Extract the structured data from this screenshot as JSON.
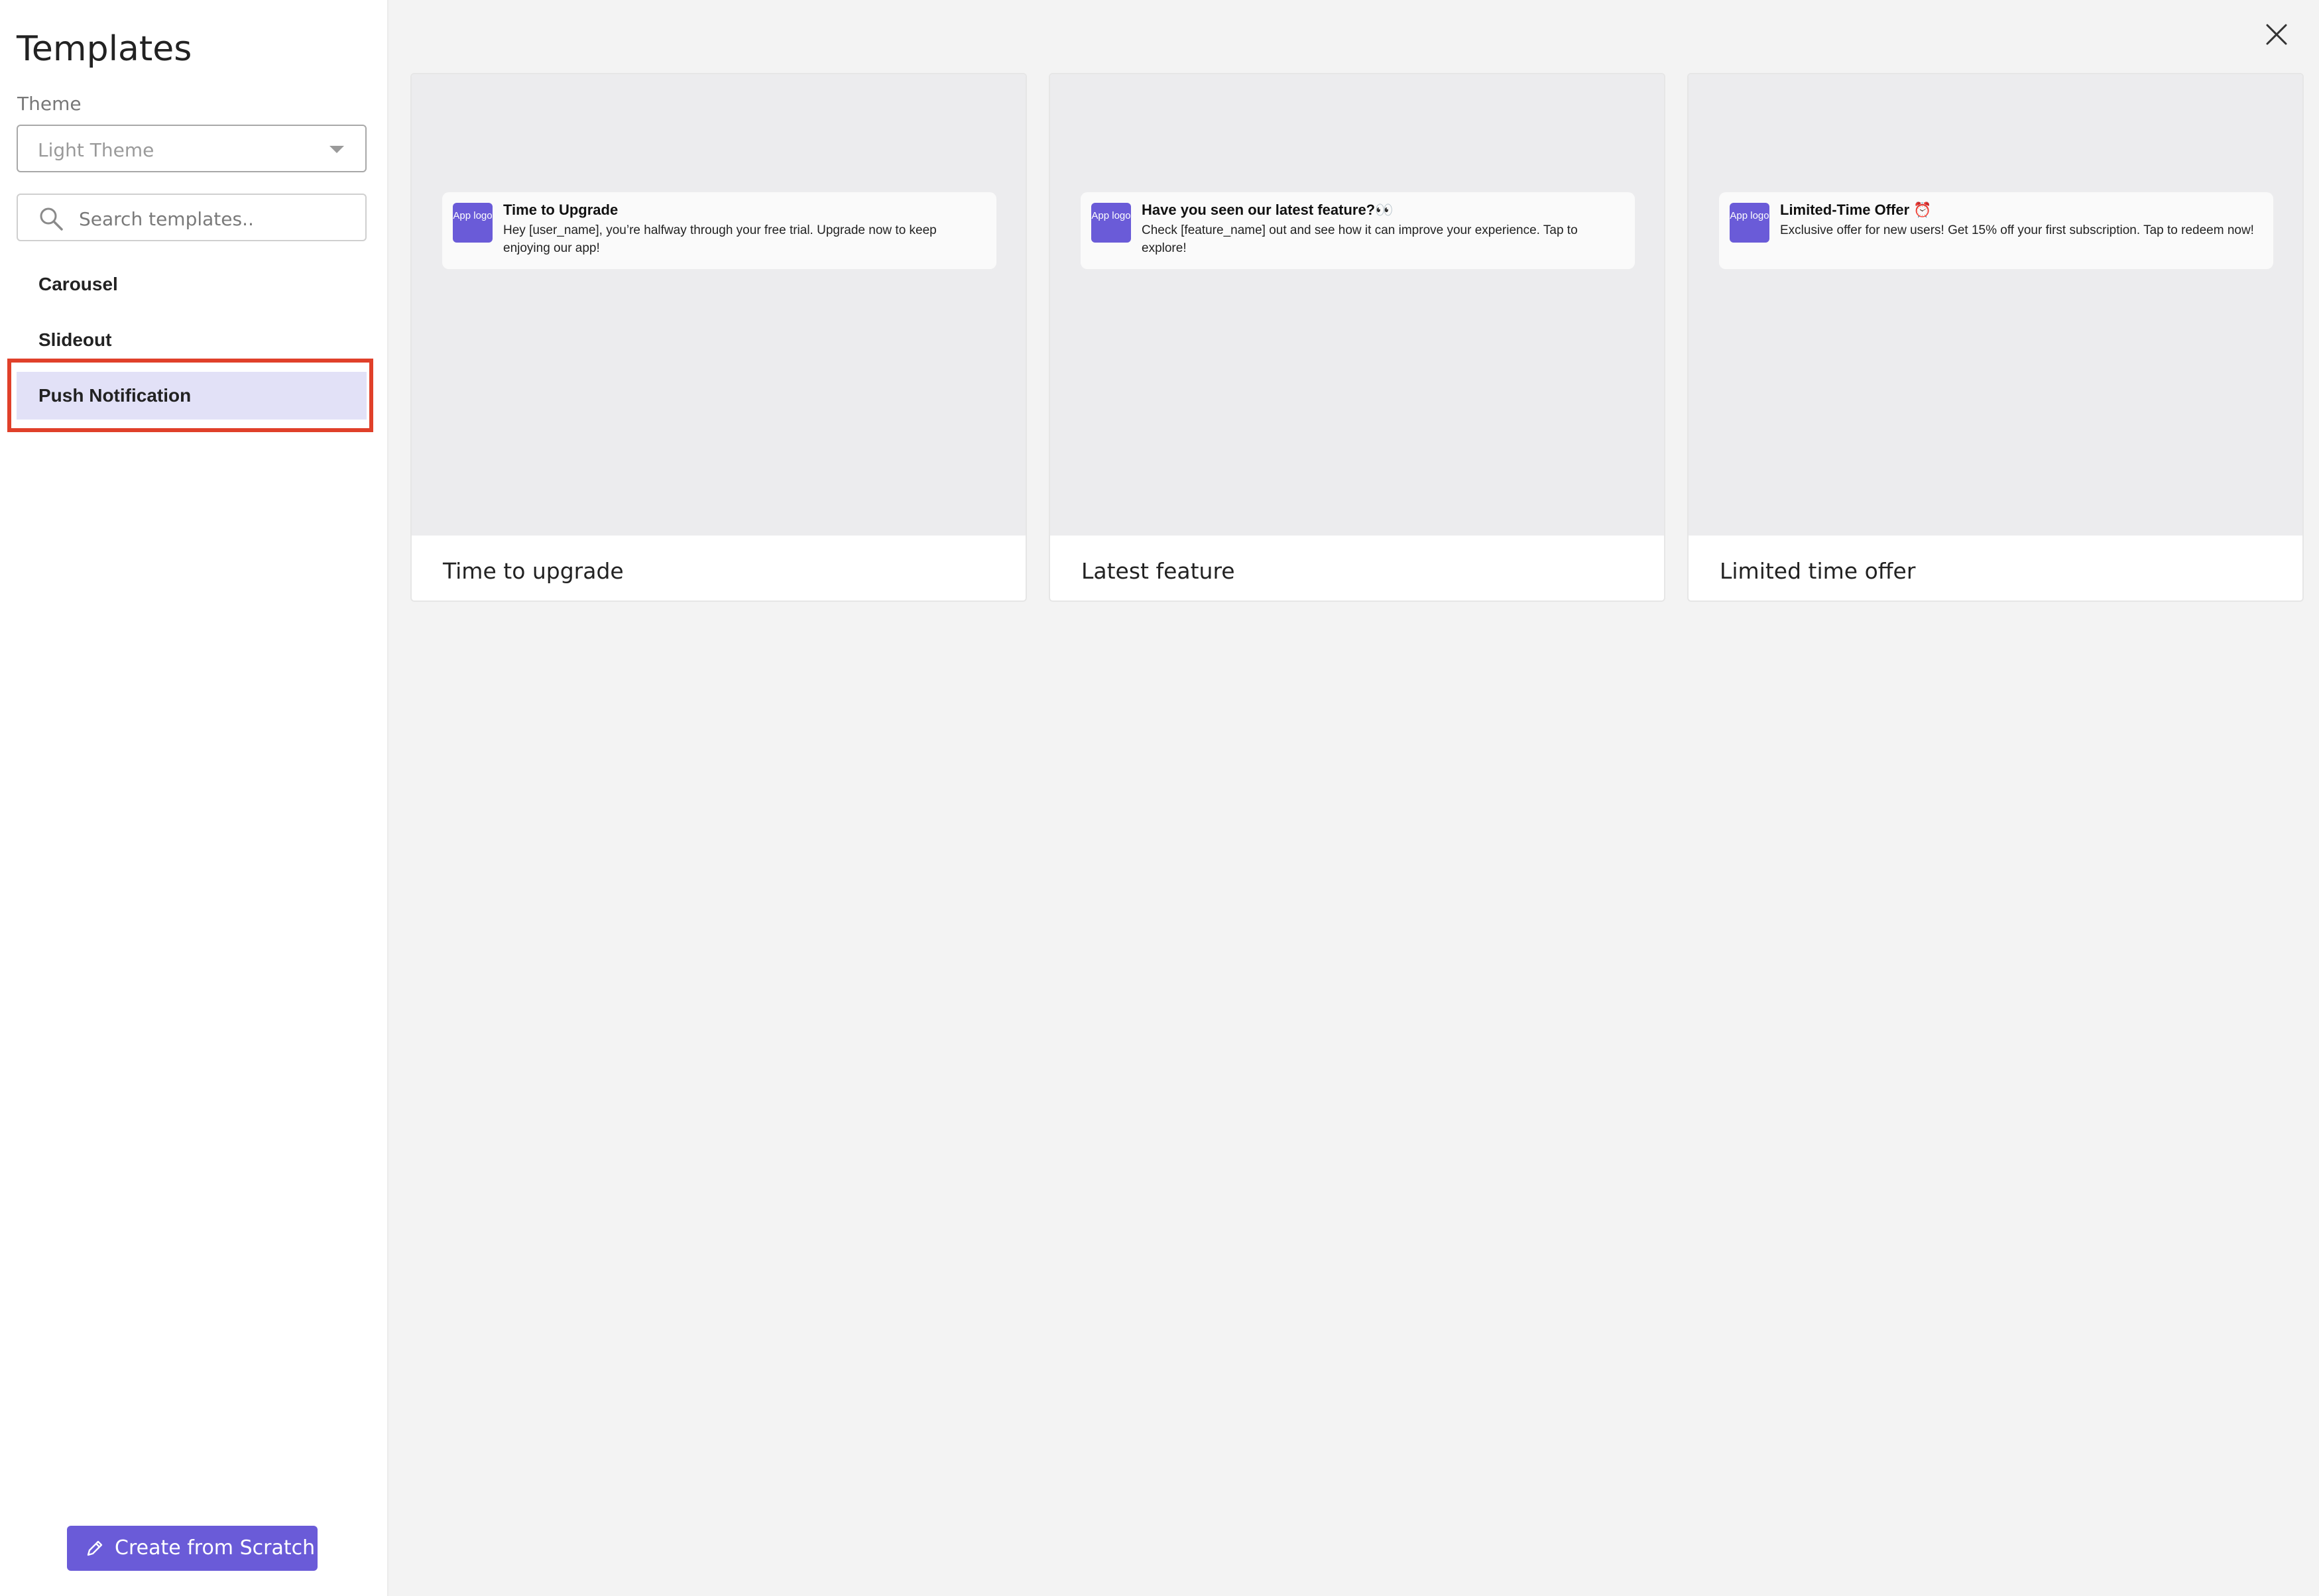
{
  "sidebar": {
    "title": "Templates",
    "theme_label": "Theme",
    "theme_value": "Light Theme",
    "search_placeholder": "Search templates..",
    "nav_items": [
      {
        "label": "Carousel",
        "active": false
      },
      {
        "label": "Slideout",
        "active": false
      },
      {
        "label": "Push Notification",
        "active": true
      }
    ],
    "create_button": "Create from Scratch"
  },
  "cards": [
    {
      "logo_text": "App logo",
      "notif_title": "Time to Upgrade",
      "notif_body": "Hey [user_name], you’re halfway through your free trial. Upgrade now to keep enjoying our app!",
      "caption": "Time to upgrade"
    },
    {
      "logo_text": "App logo",
      "notif_title": "Have you seen our latest feature?👀",
      "notif_body": "Check [feature_name] out and see how it can improve your experience. Tap to explore!",
      "caption": "Latest feature"
    },
    {
      "logo_text": "App logo",
      "notif_title": "Limited-Time Offer ⏰",
      "notif_body": "Exclusive offer for new users! Get 15% off your first subscription. Tap to redeem now!",
      "caption": "Limited time offer"
    }
  ],
  "colors": {
    "accent": "#6a5bd8",
    "active_item_bg": "#e2e1f7",
    "highlight_border": "#e0402a"
  },
  "icons": {
    "close": "close-icon",
    "search": "search-icon",
    "pencil": "pencil-icon",
    "dropdown": "chevron-down-icon"
  }
}
